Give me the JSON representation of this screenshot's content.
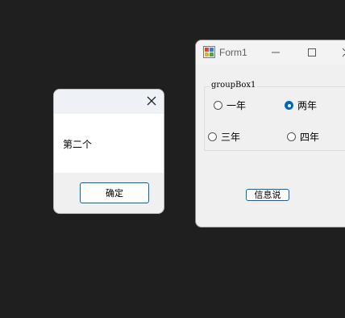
{
  "message_box": {
    "text": "第二个",
    "ok_label": "确定",
    "close_icon": "close-icon"
  },
  "form1": {
    "title": "Form1",
    "app_icon": "form-app-icon",
    "minimize_icon": "minimize-icon",
    "maximize_icon": "maximize-icon",
    "close_icon": "close-icon",
    "groupbox": {
      "label": "groupBox1",
      "options": [
        {
          "label": "一年",
          "checked": false
        },
        {
          "label": "两年",
          "checked": true
        },
        {
          "label": "三年",
          "checked": false
        },
        {
          "label": "四年",
          "checked": false
        }
      ]
    },
    "button_label": "信息说"
  },
  "colors": {
    "desktop_background": "#1f1f1f",
    "accent": "#0067c0"
  }
}
